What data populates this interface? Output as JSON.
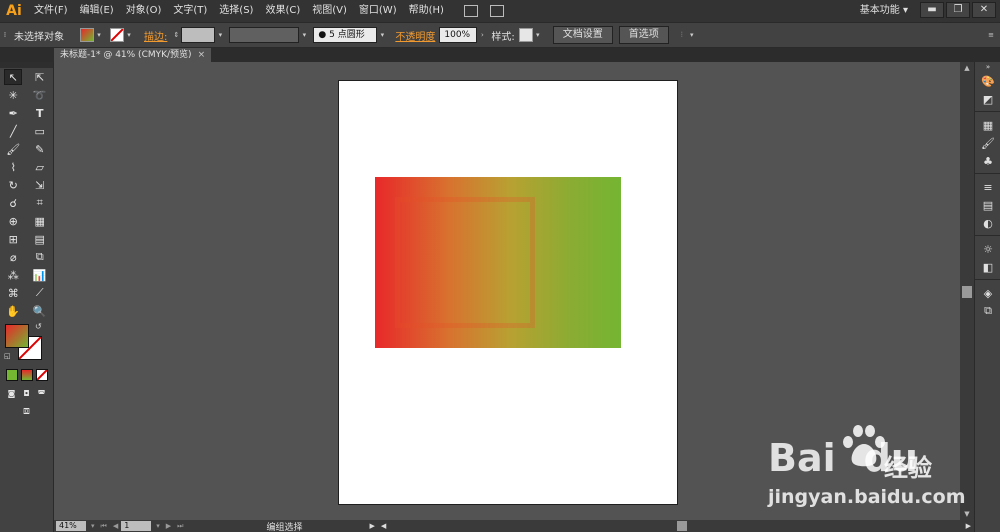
{
  "app": {
    "logo": "Ai",
    "workspace": "基本功能"
  },
  "menu": [
    "文件(F)",
    "编辑(E)",
    "对象(O)",
    "文字(T)",
    "选择(S)",
    "效果(C)",
    "视图(V)",
    "窗口(W)",
    "帮助(H)"
  ],
  "window_controls": {
    "minimize": "▬",
    "restore": "❐",
    "close": "✕"
  },
  "controlbar": {
    "selection_status": "未选择对象",
    "stroke_label": "描边:",
    "brush_value": "5 点圆形",
    "opacity_label": "不透明度",
    "opacity_value": "100%",
    "style_label": "样式:",
    "doc_setup_button": "文档设置",
    "preferences_button": "首选项"
  },
  "document_tab": {
    "title": "未标题-1* @ 41% (CMYK/预览)",
    "close": "×"
  },
  "statusbar": {
    "zoom": "41%",
    "artboard": "1",
    "status_text": "编组选择"
  },
  "colors": {
    "gradient_start": "#e8282a",
    "gradient_end": "#74b532",
    "accent": "#f19a30"
  },
  "watermark": {
    "brand": "Bai",
    "brand_suffix": "du",
    "product": "经验",
    "url": "jingyan.baidu.com"
  }
}
